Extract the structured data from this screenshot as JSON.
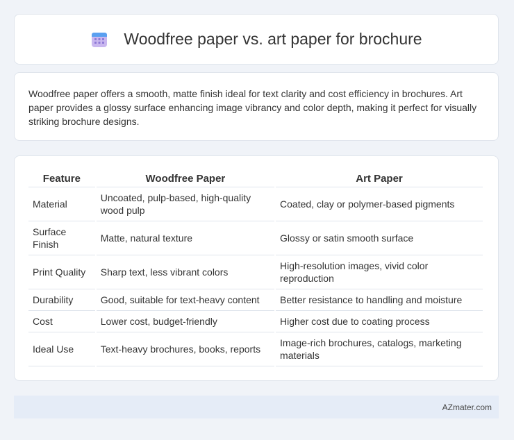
{
  "header": {
    "title": "Woodfree paper vs. art paper for brochure",
    "icon": "calendar-grid-icon"
  },
  "intro": {
    "text": "Woodfree paper offers a smooth, matte finish ideal for text clarity and cost efficiency in brochures. Art paper provides a glossy surface enhancing image vibrancy and color depth, making it perfect for visually striking brochure designs."
  },
  "table": {
    "headers": [
      "Feature",
      "Woodfree Paper",
      "Art Paper"
    ],
    "rows": [
      [
        "Material",
        "Uncoated, pulp-based, high-quality wood pulp",
        "Coated, clay or polymer-based pigments"
      ],
      [
        "Surface Finish",
        "Matte, natural texture",
        "Glossy or satin smooth surface"
      ],
      [
        "Print Quality",
        "Sharp text, less vibrant colors",
        "High-resolution images, vivid color reproduction"
      ],
      [
        "Durability",
        "Good, suitable for text-heavy content",
        "Better resistance to handling and moisture"
      ],
      [
        "Cost",
        "Lower cost, budget-friendly",
        "Higher cost due to coating process"
      ],
      [
        "Ideal Use",
        "Text-heavy brochures, books, reports",
        "Image-rich brochures, catalogs, marketing materials"
      ]
    ]
  },
  "footer": {
    "brand": "AZmater.com"
  },
  "colors": {
    "background": "#f0f3f8",
    "card": "#ffffff",
    "border": "#dfe4ec",
    "footer": "#e5ecf7",
    "icon_top": "#5aa0f0",
    "icon_body": "#c9b7ef"
  }
}
